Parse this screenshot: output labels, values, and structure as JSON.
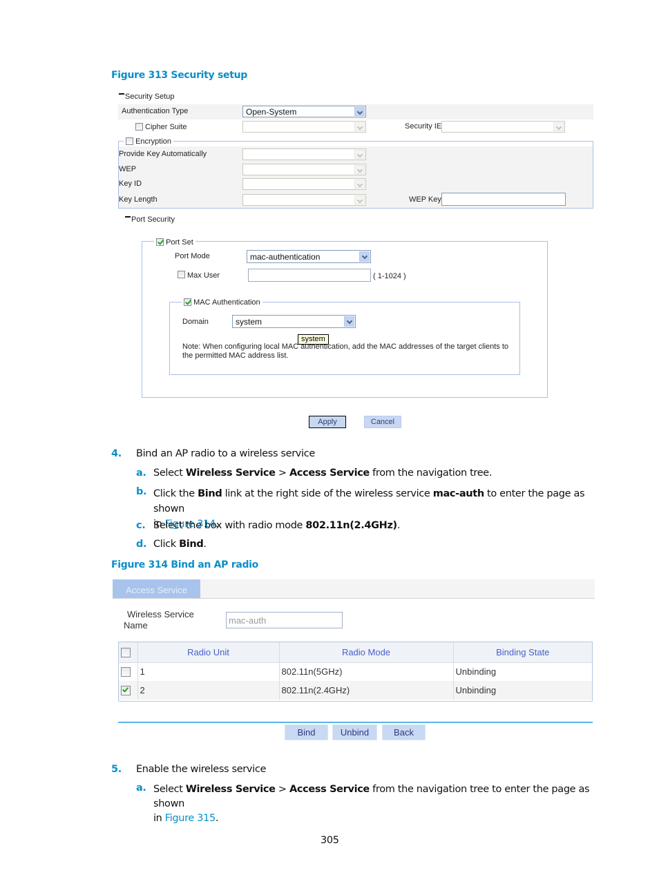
{
  "figure313": {
    "caption": "Figure 313 Security setup",
    "security_setup": {
      "section_label": "Security Setup",
      "auth_type_label": "Authentication Type",
      "auth_type_value": "Open-System",
      "cipher_suite_label": "Cipher Suite",
      "cipher_suite_checked": false,
      "security_ie_label": "Security IE",
      "encryption_label": "Encryption",
      "encryption_checked": false,
      "provide_key_label": "Provide Key Automatically",
      "wep_label": "WEP",
      "key_id_label": "Key ID",
      "key_length_label": "Key Length",
      "wep_key_label": "WEP Key"
    },
    "port_security": {
      "section_label": "Port Security",
      "port_set_label": "Port Set",
      "port_set_checked": true,
      "port_mode_label": "Port Mode",
      "port_mode_value": "mac-authentication",
      "max_user_label": "Max User",
      "max_user_checked": false,
      "max_user_value": "",
      "max_user_range": "( 1-1024 )",
      "mac_auth_label": "MAC Authentication",
      "mac_auth_checked": true,
      "domain_label": "Domain",
      "domain_value": "system",
      "tooltip": "system",
      "note_line1": "Note: When configuring local MAC authentication, add the MAC addresses of the target clients to",
      "note_line2": "the permitted MAC address list."
    },
    "buttons": {
      "apply": "Apply",
      "cancel": "Cancel"
    }
  },
  "steps": {
    "step4": {
      "num": "4.",
      "text": "Bind an AP radio to a wireless service",
      "a": {
        "label": "a.",
        "t1": "Select ",
        "b1": "Wireless Service",
        "t2": " > ",
        "b2": "Access Service",
        "t3": " from the navigation tree."
      },
      "b": {
        "label": "b.",
        "t1": "Click the ",
        "b1": "Bind",
        "t2": " link at the right side of the wireless service ",
        "b2": "mac-auth",
        "t3": " to enter the page as shown",
        "t4": "in ",
        "link": "Figure 314",
        "t5": "."
      },
      "c": {
        "label": "c.",
        "t1": "Select the box with radio mode ",
        "b1": "802.11n(2.4GHz)",
        "t2": "."
      },
      "d": {
        "label": "d.",
        "t1": "Click ",
        "b1": "Bind",
        "t2": "."
      }
    },
    "step5": {
      "num": "5.",
      "text": "Enable the wireless service",
      "a": {
        "label": "a.",
        "t1": "Select ",
        "b1": "Wireless Service",
        "t2": " > ",
        "b2": "Access Service",
        "t3": " from the navigation tree to enter the page as shown",
        "t4": "in ",
        "link": "Figure 315",
        "t5": "."
      }
    }
  },
  "figure314": {
    "caption": "Figure 314 Bind an AP radio",
    "tab_label": "Access Service",
    "service_name_label_line1": "Wireless Service",
    "service_name_label_line2": "Name",
    "service_name_value": "mac-auth",
    "table": {
      "headers": [
        "Radio Unit",
        "Radio Mode",
        "Binding State"
      ],
      "rows": [
        {
          "checked": false,
          "unit": "1",
          "mode": "802.11n(5GHz)",
          "state": "Unbinding"
        },
        {
          "checked": true,
          "unit": "2",
          "mode": "802.11n(2.4GHz)",
          "state": "Unbinding"
        }
      ]
    },
    "buttons": {
      "bind": "Bind",
      "unbind": "Unbind",
      "back": "Back"
    }
  },
  "page_number": "305"
}
